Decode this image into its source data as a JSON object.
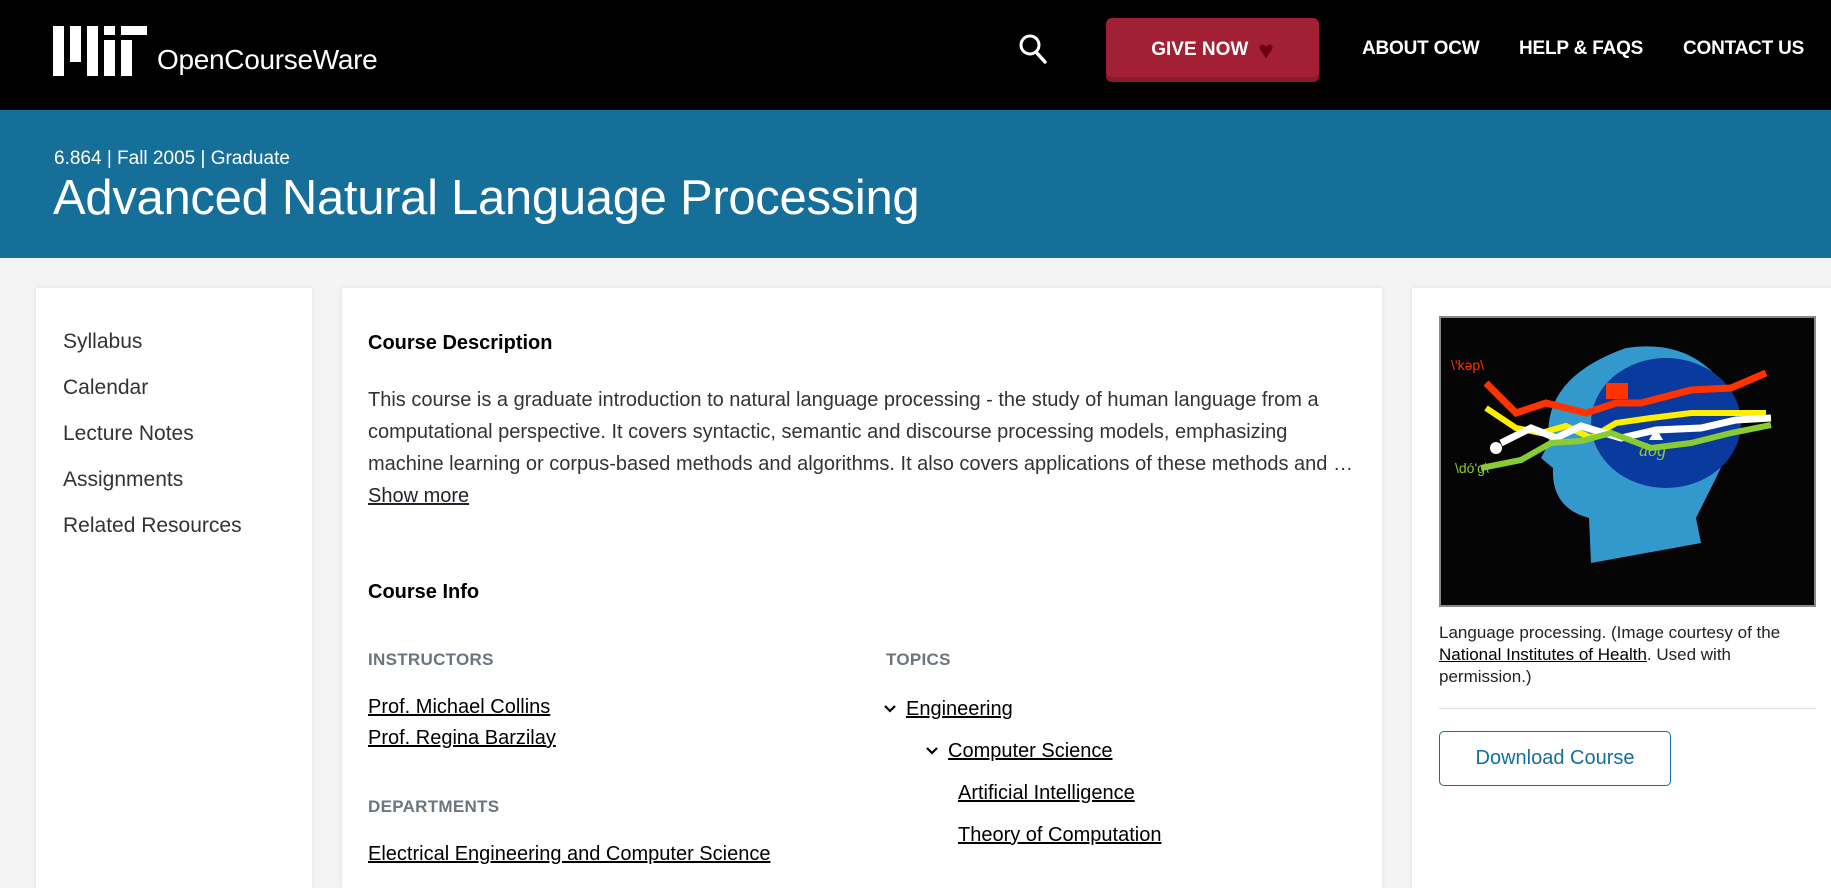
{
  "header": {
    "logo_text": "OpenCourseWare",
    "search_icon": "search-icon",
    "give_now_label": "GIVE NOW",
    "heart_icon": "♥",
    "nav": [
      "ABOUT OCW",
      "HELP & FAQS",
      "CONTACT US"
    ]
  },
  "banner": {
    "meta": "6.864 | Fall 2005 | Graduate",
    "title": "Advanced Natural Language Processing"
  },
  "sidebar": {
    "items": [
      "Syllabus",
      "Calendar",
      "Lecture Notes",
      "Assignments",
      "Related Resources"
    ]
  },
  "main": {
    "description_heading": "Course Description",
    "description_text": "This course is a graduate introduction to natural language processing - the study of human language from a computational perspective. It covers syntactic, semantic and discourse processing models, emphasizing machine learning or corpus-based methods and algorithms. It also covers applications of these methods and …",
    "show_more": "Show more",
    "info_heading": "Course Info",
    "instructors_label": "INSTRUCTORS",
    "instructors": [
      "Prof. Michael Collins",
      "Prof. Regina Barzilay"
    ],
    "departments_label": "DEPARTMENTS",
    "departments": [
      "Electrical Engineering and Computer Science"
    ],
    "topics_label": "TOPICS",
    "topics": {
      "level1": "Engineering",
      "level2": "Computer Science",
      "level3": [
        "Artificial Intelligence",
        "Theory of Computation"
      ]
    }
  },
  "right": {
    "image_alt": "Language processing illustration: head silhouette with sound waves",
    "image_labels": [
      "\\'kəp\\",
      "\\dó'g\\",
      "dog"
    ],
    "caption_prefix": "Language processing. (Image courtesy of the ",
    "caption_link": "National Institutes of Health",
    "caption_suffix": ". Used with permission.)",
    "download_label": "Download Course"
  },
  "colors": {
    "header_bg": "#000000",
    "banner_bg": "#156f99",
    "give_button": "#a31f34",
    "page_bg": "#f4f4f4"
  }
}
